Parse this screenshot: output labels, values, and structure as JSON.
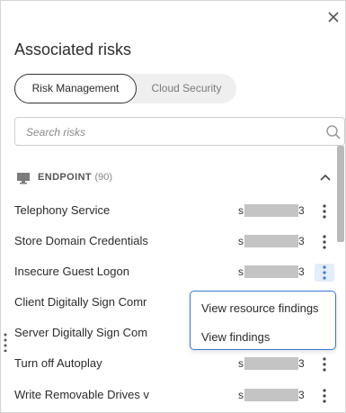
{
  "panel": {
    "title": "Associated risks"
  },
  "tabs": [
    {
      "label": "Risk Management",
      "active": true
    },
    {
      "label": "Cloud Security",
      "active": false
    }
  ],
  "search": {
    "placeholder": "Search risks",
    "value": ""
  },
  "group": {
    "name": "ENDPOINT",
    "count": "(90)",
    "icon": "monitor-icon",
    "expanded": true
  },
  "rows": [
    {
      "name": "Telephony Service",
      "owner_first": "s",
      "owner_last": "3"
    },
    {
      "name": "Store Domain Credentials",
      "owner_first": "s",
      "owner_last": "3"
    },
    {
      "name": "Insecure Guest Logon",
      "owner_first": "s",
      "owner_last": "3"
    },
    {
      "name": "Client Digitally Sign Comr",
      "owner_first": "",
      "owner_last": ""
    },
    {
      "name": "Server Digitally Sign Com",
      "owner_first": "",
      "owner_last": ""
    },
    {
      "name": "Turn off Autoplay",
      "owner_first": "s",
      "owner_last": "3"
    },
    {
      "name": "Write Removable Drives v",
      "owner_first": "s",
      "owner_last": "3"
    }
  ],
  "context_menu": {
    "items": [
      "View resource findings",
      "View findings"
    ]
  },
  "colors": {
    "accent": "#3b77d8",
    "active_kebab_bg": "#e4edf9",
    "tab_track": "#efefef",
    "redaction": "#c4c4c4"
  }
}
